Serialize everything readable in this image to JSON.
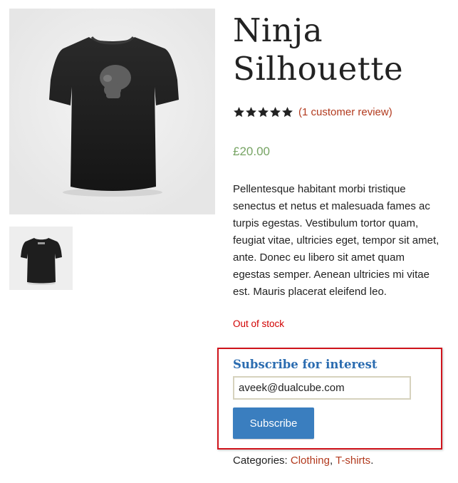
{
  "product": {
    "title": "Ninja Silhouette",
    "rating": {
      "stars": 5,
      "max": 5,
      "review_text": "(1 customer review)"
    },
    "price": "£20.00",
    "description": "Pellentesque habitant morbi tristique senectus et netus et malesuada fames ac turpis egestas. Vestibulum tortor quam, feugiat vitae, ultricies eget, tempor sit amet, ante. Donec eu libero sit amet quam egestas semper. Aenean ultricies mi vitae est. Mauris placerat eleifend leo.",
    "stock_status": "Out of stock"
  },
  "gallery": {
    "main_image_icon": "tshirt-front-image",
    "thumbnail_icon": "tshirt-back-image"
  },
  "subscribe": {
    "title": "Subscribe for interest",
    "email_value": "aveek@dualcube.com",
    "button_label": "Subscribe"
  },
  "categories": {
    "label": "Categories:",
    "items": [
      "Clothing",
      "T-shirts"
    ],
    "separator": ", ",
    "end": "."
  },
  "colors": {
    "link": "#b23a1e",
    "price": "#77a464",
    "stock": "#d10000",
    "subscribe_title": "#2b6cb0",
    "button": "#3a7ebf",
    "highlight_border": "#d0141c"
  }
}
